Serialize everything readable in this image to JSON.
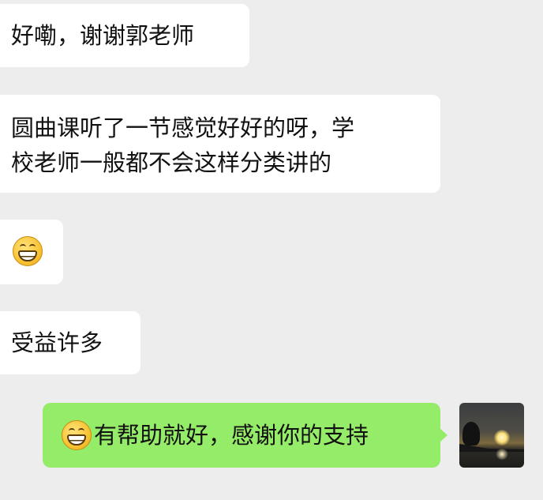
{
  "messages": {
    "m1": "好嘞，谢谢郭老师",
    "m2_line1": "圆曲课听了一节感觉好好的呀，学",
    "m2_line2": "校老师一般都不会这样分类讲的",
    "m3_emoji": "grinning-face-icon",
    "m4": "受益许多",
    "m5": "有帮助就好，感谢你的支持"
  },
  "colors": {
    "background": "#ededed",
    "incoming_bubble": "#ffffff",
    "outgoing_bubble": "#95ec69",
    "text": "#111111"
  },
  "avatar": {
    "icon": "sunset-landscape-avatar"
  }
}
